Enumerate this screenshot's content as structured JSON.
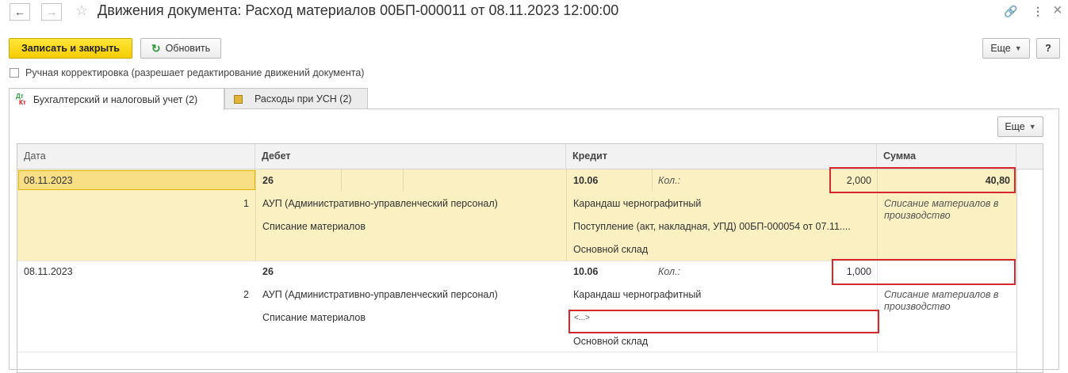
{
  "window": {
    "title": "Движения документа: Расход материалов 00БП-000011 от 08.11.2023 12:00:00",
    "back_icon": "←",
    "forward_icon": "→",
    "star_icon": "☆",
    "link_icon": "🔗",
    "menu_icon": "⋮",
    "close_icon": "×"
  },
  "toolbar": {
    "save_close_label": "Записать и закрыть",
    "refresh_label": "Обновить",
    "more_label": "Еще",
    "help_label": "?"
  },
  "manual_correction": {
    "checked": false,
    "label": "Ручная корректировка (разрешает редактирование движений документа)"
  },
  "tabs": [
    {
      "label": "Бухгалтерский и налоговый учет (2)",
      "icon": "dt-kt-icon",
      "icon_top": "Дт",
      "icon_bottom": "Кт",
      "active": true
    },
    {
      "label": "Расходы при УСН (2)",
      "icon": "usn-icon",
      "active": false
    }
  ],
  "table": {
    "more_label": "Еще",
    "columns": [
      "Дата",
      "Дебет",
      "Кредит",
      "Сумма"
    ],
    "rows": [
      {
        "date": "08.11.2023",
        "number": "1",
        "debit_account": "26",
        "debit_sub1": "АУП (Административно-управленческий персонал)",
        "debit_sub2": "Списание материалов",
        "credit_account": "10.06",
        "qty_label": "Кол.:",
        "qty": "2,000",
        "credit_sub1": "Карандаш чернографитный",
        "credit_sub2": "Поступление (акт, накладная, УПД) 00БП-000054 от 07.11....",
        "credit_sub3": "Основной склад",
        "amount": "40,80",
        "description": "Списание материалов в производство"
      },
      {
        "date": "08.11.2023",
        "number": "2",
        "debit_account": "26",
        "debit_sub1": "АУП (Административно-управленческий персонал)",
        "debit_sub2": "Списание материалов",
        "credit_account": "10.06",
        "qty_label": "Кол.:",
        "qty": "1,000",
        "credit_sub1": "Карандаш чернографитный",
        "credit_sub2": "<...>",
        "credit_sub3": "Основной склад",
        "amount": "",
        "description": "Списание материалов в производство"
      }
    ]
  },
  "colors": {
    "selected_row_bg": "#fbf0c2",
    "primary_button": "#f5cc00",
    "highlight_border": "#d8262d"
  }
}
